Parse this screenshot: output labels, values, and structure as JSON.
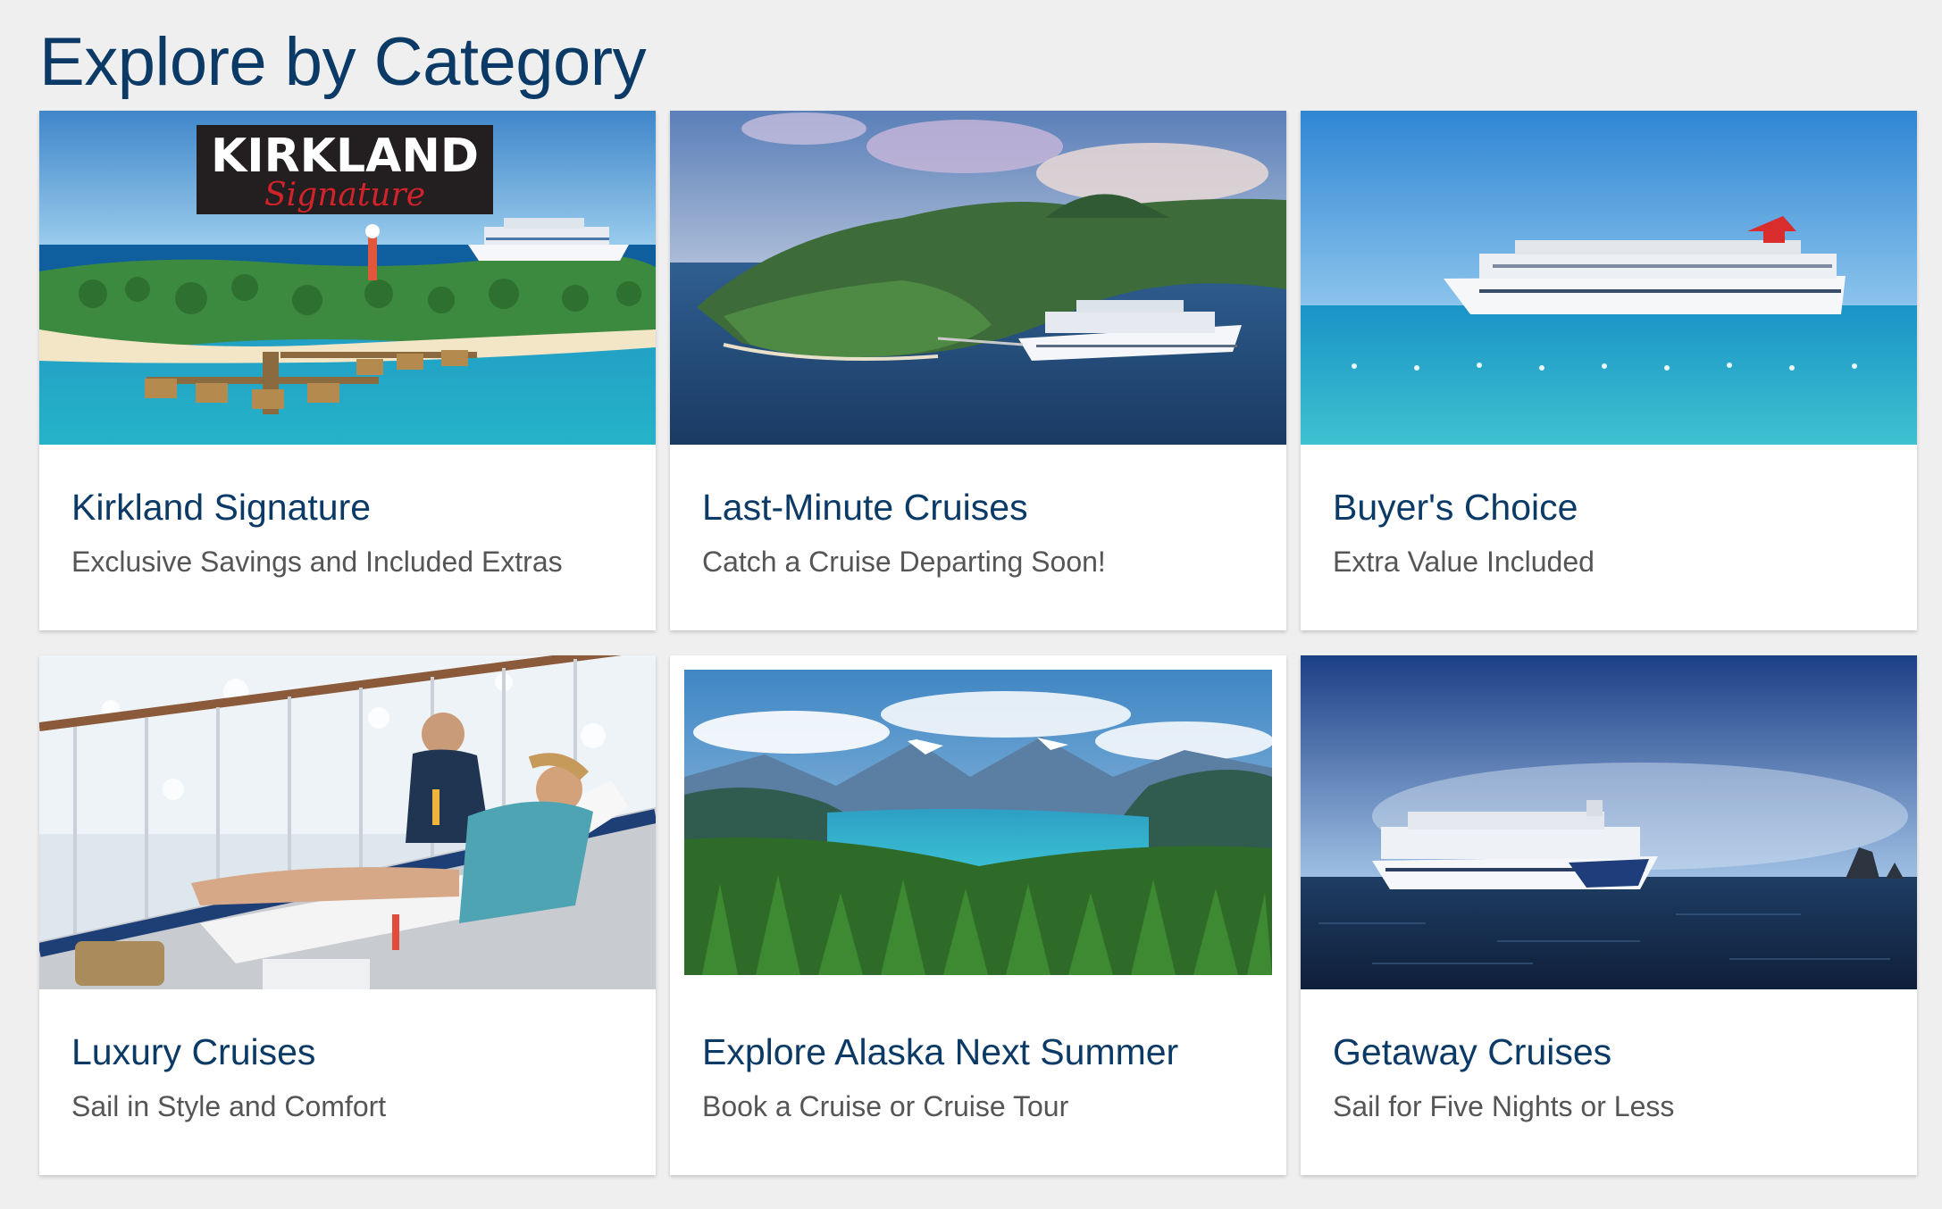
{
  "page": {
    "title": "Explore by Category"
  },
  "categories": [
    {
      "title": "Kirkland Signature",
      "subtitle": "Exclusive Savings and Included Extras",
      "image": "tropical-island-resort-with-cruise-ship",
      "logo": {
        "line1": "KIRKLAND",
        "line2": "Signature"
      }
    },
    {
      "title": "Last-Minute Cruises",
      "subtitle": "Catch a Cruise Departing Soon!",
      "image": "cruise-ship-docked-at-mountain-island"
    },
    {
      "title": "Buyer's Choice",
      "subtitle": "Extra Value Included",
      "image": "cruise-ship-on-turquoise-sea"
    },
    {
      "title": "Luxury Cruises",
      "subtitle": "Sail in Style and Comfort",
      "image": "couple-relaxing-on-cruise-deck"
    },
    {
      "title": "Explore Alaska Next Summer",
      "subtitle": "Book a Cruise or Cruise Tour",
      "image": "alaska-fjord-with-forest-and-mountains"
    },
    {
      "title": "Getaway Cruises",
      "subtitle": "Sail for Five Nights or Less",
      "image": "cruise-ship-on-dark-ocean"
    }
  ],
  "colors": {
    "background": "#efefef",
    "title": "#0b3a66",
    "subtitle": "#555555",
    "card": "#ffffff",
    "logo_red": "#d2232a"
  }
}
